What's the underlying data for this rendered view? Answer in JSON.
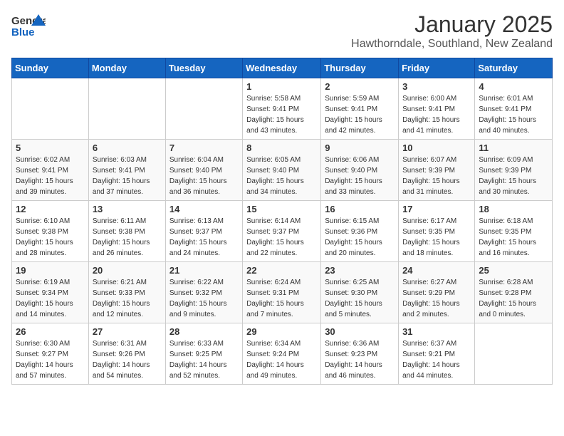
{
  "header": {
    "logo": {
      "line1": "General",
      "line2": "Blue"
    },
    "title": "January 2025",
    "location": "Hawthorndale, Southland, New Zealand"
  },
  "days_of_week": [
    "Sunday",
    "Monday",
    "Tuesday",
    "Wednesday",
    "Thursday",
    "Friday",
    "Saturday"
  ],
  "weeks": [
    [
      {
        "day": "",
        "info": ""
      },
      {
        "day": "",
        "info": ""
      },
      {
        "day": "",
        "info": ""
      },
      {
        "day": "1",
        "info": "Sunrise: 5:58 AM\nSunset: 9:41 PM\nDaylight: 15 hours\nand 43 minutes."
      },
      {
        "day": "2",
        "info": "Sunrise: 5:59 AM\nSunset: 9:41 PM\nDaylight: 15 hours\nand 42 minutes."
      },
      {
        "day": "3",
        "info": "Sunrise: 6:00 AM\nSunset: 9:41 PM\nDaylight: 15 hours\nand 41 minutes."
      },
      {
        "day": "4",
        "info": "Sunrise: 6:01 AM\nSunset: 9:41 PM\nDaylight: 15 hours\nand 40 minutes."
      }
    ],
    [
      {
        "day": "5",
        "info": "Sunrise: 6:02 AM\nSunset: 9:41 PM\nDaylight: 15 hours\nand 39 minutes."
      },
      {
        "day": "6",
        "info": "Sunrise: 6:03 AM\nSunset: 9:41 PM\nDaylight: 15 hours\nand 37 minutes."
      },
      {
        "day": "7",
        "info": "Sunrise: 6:04 AM\nSunset: 9:40 PM\nDaylight: 15 hours\nand 36 minutes."
      },
      {
        "day": "8",
        "info": "Sunrise: 6:05 AM\nSunset: 9:40 PM\nDaylight: 15 hours\nand 34 minutes."
      },
      {
        "day": "9",
        "info": "Sunrise: 6:06 AM\nSunset: 9:40 PM\nDaylight: 15 hours\nand 33 minutes."
      },
      {
        "day": "10",
        "info": "Sunrise: 6:07 AM\nSunset: 9:39 PM\nDaylight: 15 hours\nand 31 minutes."
      },
      {
        "day": "11",
        "info": "Sunrise: 6:09 AM\nSunset: 9:39 PM\nDaylight: 15 hours\nand 30 minutes."
      }
    ],
    [
      {
        "day": "12",
        "info": "Sunrise: 6:10 AM\nSunset: 9:38 PM\nDaylight: 15 hours\nand 28 minutes."
      },
      {
        "day": "13",
        "info": "Sunrise: 6:11 AM\nSunset: 9:38 PM\nDaylight: 15 hours\nand 26 minutes."
      },
      {
        "day": "14",
        "info": "Sunrise: 6:13 AM\nSunset: 9:37 PM\nDaylight: 15 hours\nand 24 minutes."
      },
      {
        "day": "15",
        "info": "Sunrise: 6:14 AM\nSunset: 9:37 PM\nDaylight: 15 hours\nand 22 minutes."
      },
      {
        "day": "16",
        "info": "Sunrise: 6:15 AM\nSunset: 9:36 PM\nDaylight: 15 hours\nand 20 minutes."
      },
      {
        "day": "17",
        "info": "Sunrise: 6:17 AM\nSunset: 9:35 PM\nDaylight: 15 hours\nand 18 minutes."
      },
      {
        "day": "18",
        "info": "Sunrise: 6:18 AM\nSunset: 9:35 PM\nDaylight: 15 hours\nand 16 minutes."
      }
    ],
    [
      {
        "day": "19",
        "info": "Sunrise: 6:19 AM\nSunset: 9:34 PM\nDaylight: 15 hours\nand 14 minutes."
      },
      {
        "day": "20",
        "info": "Sunrise: 6:21 AM\nSunset: 9:33 PM\nDaylight: 15 hours\nand 12 minutes."
      },
      {
        "day": "21",
        "info": "Sunrise: 6:22 AM\nSunset: 9:32 PM\nDaylight: 15 hours\nand 9 minutes."
      },
      {
        "day": "22",
        "info": "Sunrise: 6:24 AM\nSunset: 9:31 PM\nDaylight: 15 hours\nand 7 minutes."
      },
      {
        "day": "23",
        "info": "Sunrise: 6:25 AM\nSunset: 9:30 PM\nDaylight: 15 hours\nand 5 minutes."
      },
      {
        "day": "24",
        "info": "Sunrise: 6:27 AM\nSunset: 9:29 PM\nDaylight: 15 hours\nand 2 minutes."
      },
      {
        "day": "25",
        "info": "Sunrise: 6:28 AM\nSunset: 9:28 PM\nDaylight: 15 hours\nand 0 minutes."
      }
    ],
    [
      {
        "day": "26",
        "info": "Sunrise: 6:30 AM\nSunset: 9:27 PM\nDaylight: 14 hours\nand 57 minutes."
      },
      {
        "day": "27",
        "info": "Sunrise: 6:31 AM\nSunset: 9:26 PM\nDaylight: 14 hours\nand 54 minutes."
      },
      {
        "day": "28",
        "info": "Sunrise: 6:33 AM\nSunset: 9:25 PM\nDaylight: 14 hours\nand 52 minutes."
      },
      {
        "day": "29",
        "info": "Sunrise: 6:34 AM\nSunset: 9:24 PM\nDaylight: 14 hours\nand 49 minutes."
      },
      {
        "day": "30",
        "info": "Sunrise: 6:36 AM\nSunset: 9:23 PM\nDaylight: 14 hours\nand 46 minutes."
      },
      {
        "day": "31",
        "info": "Sunrise: 6:37 AM\nSunset: 9:21 PM\nDaylight: 14 hours\nand 44 minutes."
      },
      {
        "day": "",
        "info": ""
      }
    ]
  ]
}
